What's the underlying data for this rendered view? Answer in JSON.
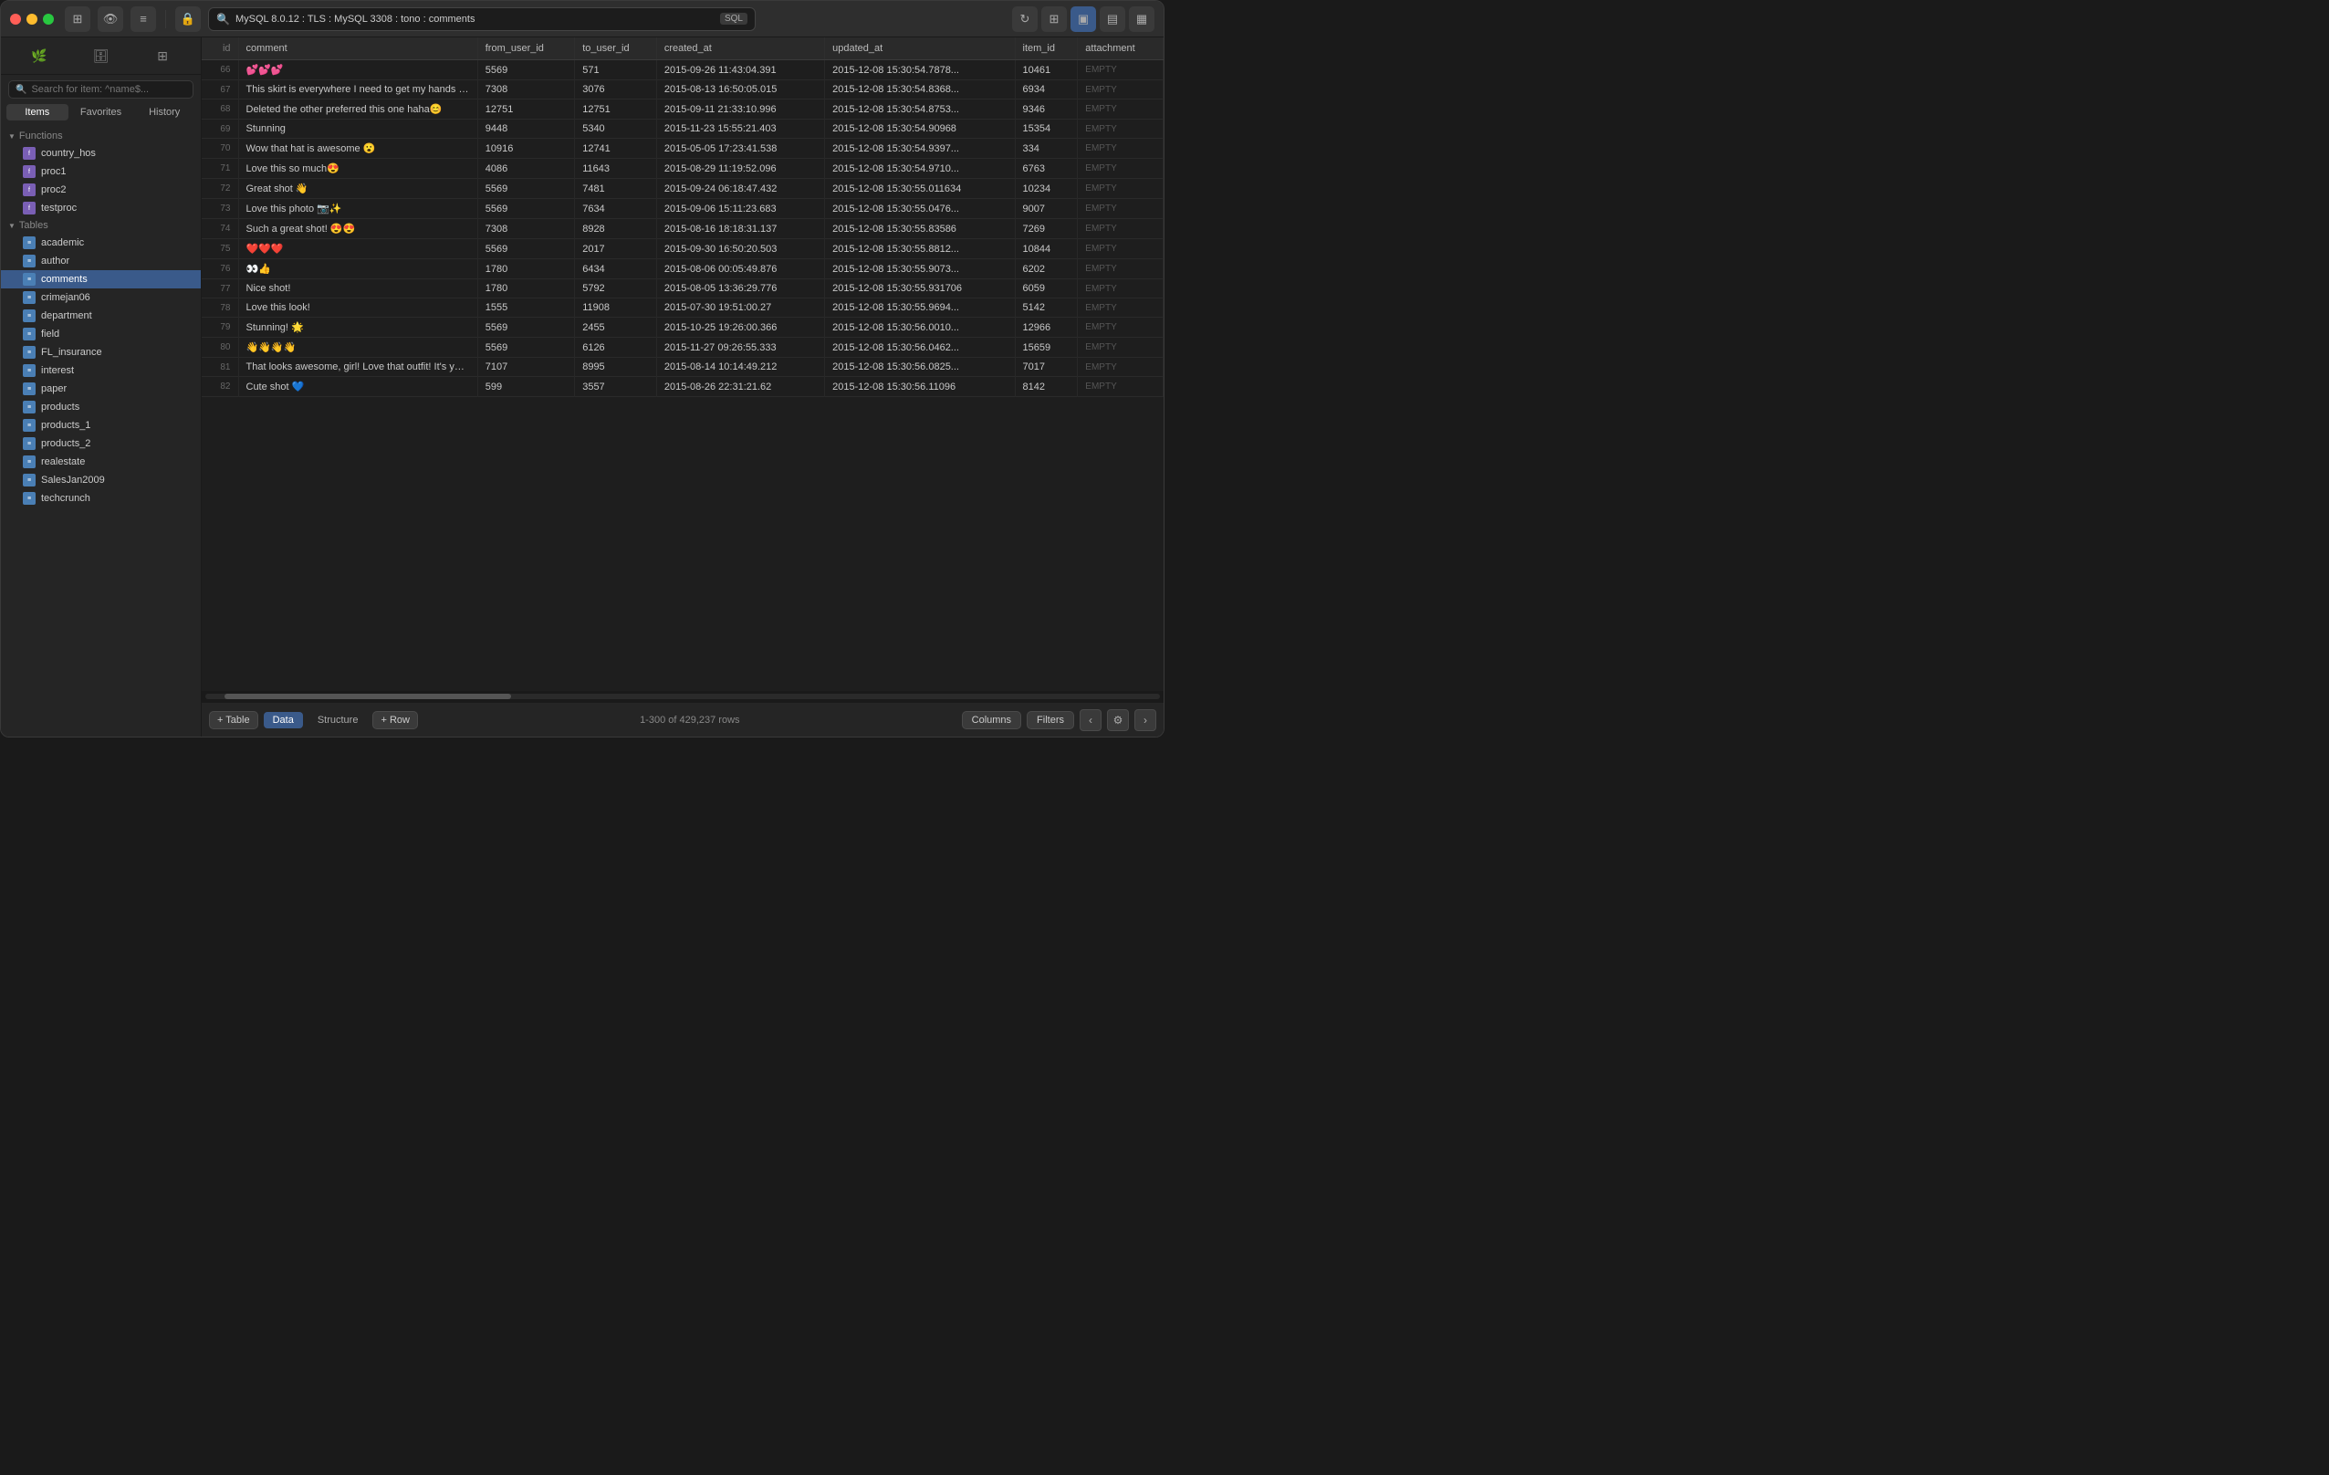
{
  "titlebar": {
    "connection": "MySQL 8.0.12 : TLS : MySQL 3308 : tono : comments",
    "search_placeholder": "Search for item: ^name$...",
    "sql_label": "SQL"
  },
  "sidebar": {
    "search_placeholder": "Search for item: ^name$...",
    "tabs": [
      "Items",
      "Favorites",
      "History"
    ],
    "active_tab": "Items",
    "sections": {
      "functions": {
        "label": "Functions",
        "items": [
          "country_hos",
          "proc1",
          "proc2",
          "testproc"
        ]
      },
      "tables": {
        "label": "Tables",
        "items": [
          "academic",
          "author",
          "comments",
          "crimejan06",
          "department",
          "field",
          "FL_insurance",
          "interest",
          "paper",
          "products",
          "products_1",
          "products_2",
          "realestate",
          "SalesJan2009",
          "techcrunch"
        ],
        "active": "comments"
      }
    }
  },
  "table": {
    "columns": [
      "id",
      "comment",
      "from_user_id",
      "to_user_id",
      "created_at",
      "updated_at",
      "item_id",
      "attachment"
    ],
    "rows": [
      {
        "id": "66",
        "comment": "💕💕💕",
        "from_user_id": "5569",
        "to_user_id": "571",
        "created_at": "2015-09-26 11:43:04.391",
        "updated_at": "2015-12-08 15:30:54.7878...",
        "item_id": "10461",
        "attachment": "EMPTY"
      },
      {
        "id": "67",
        "comment": "This skirt is everywhere I need to get my hands on it!...",
        "from_user_id": "7308",
        "to_user_id": "3076",
        "created_at": "2015-08-13 16:50:05.015",
        "updated_at": "2015-12-08 15:30:54.8368...",
        "item_id": "6934",
        "attachment": "EMPTY"
      },
      {
        "id": "68",
        "comment": "Deleted the other preferred this one haha😊",
        "from_user_id": "12751",
        "to_user_id": "12751",
        "created_at": "2015-09-11 21:33:10.996",
        "updated_at": "2015-12-08 15:30:54.8753...",
        "item_id": "9346",
        "attachment": "EMPTY"
      },
      {
        "id": "69",
        "comment": "Stunning",
        "from_user_id": "9448",
        "to_user_id": "5340",
        "created_at": "2015-11-23 15:55:21.403",
        "updated_at": "2015-12-08 15:30:54.90968",
        "item_id": "15354",
        "attachment": "EMPTY"
      },
      {
        "id": "70",
        "comment": "Wow that hat is awesome 😮",
        "from_user_id": "10916",
        "to_user_id": "12741",
        "created_at": "2015-05-05 17:23:41.538",
        "updated_at": "2015-12-08 15:30:54.9397...",
        "item_id": "334",
        "attachment": "EMPTY"
      },
      {
        "id": "71",
        "comment": "Love this so much😍",
        "from_user_id": "4086",
        "to_user_id": "11643",
        "created_at": "2015-08-29 11:19:52.096",
        "updated_at": "2015-12-08 15:30:54.9710...",
        "item_id": "6763",
        "attachment": "EMPTY"
      },
      {
        "id": "72",
        "comment": "Great shot 👋",
        "from_user_id": "5569",
        "to_user_id": "7481",
        "created_at": "2015-09-24 06:18:47.432",
        "updated_at": "2015-12-08 15:30:55.011634",
        "item_id": "10234",
        "attachment": "EMPTY"
      },
      {
        "id": "73",
        "comment": "Love this photo 📷✨",
        "from_user_id": "5569",
        "to_user_id": "7634",
        "created_at": "2015-09-06 15:11:23.683",
        "updated_at": "2015-12-08 15:30:55.0476...",
        "item_id": "9007",
        "attachment": "EMPTY"
      },
      {
        "id": "74",
        "comment": "Such a great shot! 😍😍",
        "from_user_id": "7308",
        "to_user_id": "8928",
        "created_at": "2015-08-16 18:18:31.137",
        "updated_at": "2015-12-08 15:30:55.83586",
        "item_id": "7269",
        "attachment": "EMPTY"
      },
      {
        "id": "75",
        "comment": "❤️❤️❤️",
        "from_user_id": "5569",
        "to_user_id": "2017",
        "created_at": "2015-09-30 16:50:20.503",
        "updated_at": "2015-12-08 15:30:55.8812...",
        "item_id": "10844",
        "attachment": "EMPTY"
      },
      {
        "id": "76",
        "comment": "👀👍",
        "from_user_id": "1780",
        "to_user_id": "6434",
        "created_at": "2015-08-06 00:05:49.876",
        "updated_at": "2015-12-08 15:30:55.9073...",
        "item_id": "6202",
        "attachment": "EMPTY"
      },
      {
        "id": "77",
        "comment": "Nice shot!",
        "from_user_id": "1780",
        "to_user_id": "5792",
        "created_at": "2015-08-05 13:36:29.776",
        "updated_at": "2015-12-08 15:30:55.931706",
        "item_id": "6059",
        "attachment": "EMPTY"
      },
      {
        "id": "78",
        "comment": "Love this look!",
        "from_user_id": "1555",
        "to_user_id": "11908",
        "created_at": "2015-07-30 19:51:00.27",
        "updated_at": "2015-12-08 15:30:55.9694...",
        "item_id": "5142",
        "attachment": "EMPTY"
      },
      {
        "id": "79",
        "comment": "Stunning! 🌟",
        "from_user_id": "5569",
        "to_user_id": "2455",
        "created_at": "2015-10-25 19:26:00.366",
        "updated_at": "2015-12-08 15:30:56.0010...",
        "item_id": "12966",
        "attachment": "EMPTY"
      },
      {
        "id": "80",
        "comment": "👋👋👋👋",
        "from_user_id": "5569",
        "to_user_id": "6126",
        "created_at": "2015-11-27 09:26:55.333",
        "updated_at": "2015-12-08 15:30:56.0462...",
        "item_id": "15659",
        "attachment": "EMPTY"
      },
      {
        "id": "81",
        "comment": "That looks awesome, girl! Love that outfit! It's your o...",
        "from_user_id": "7107",
        "to_user_id": "8995",
        "created_at": "2015-08-14 10:14:49.212",
        "updated_at": "2015-12-08 15:30:56.0825...",
        "item_id": "7017",
        "attachment": "EMPTY"
      },
      {
        "id": "82",
        "comment": "Cute shot 💙",
        "from_user_id": "599",
        "to_user_id": "3557",
        "created_at": "2015-08-26 22:31:21.62",
        "updated_at": "2015-12-08 15:30:56.11096",
        "item_id": "8142",
        "attachment": "EMPTY"
      }
    ]
  },
  "bottom_bar": {
    "add_table_label": "+ Table",
    "tab_data": "Data",
    "tab_structure": "Structure",
    "add_row_label": "+ Row",
    "row_count": "1-300 of 429,237 rows",
    "columns_label": "Columns",
    "filters_label": "Filters"
  }
}
